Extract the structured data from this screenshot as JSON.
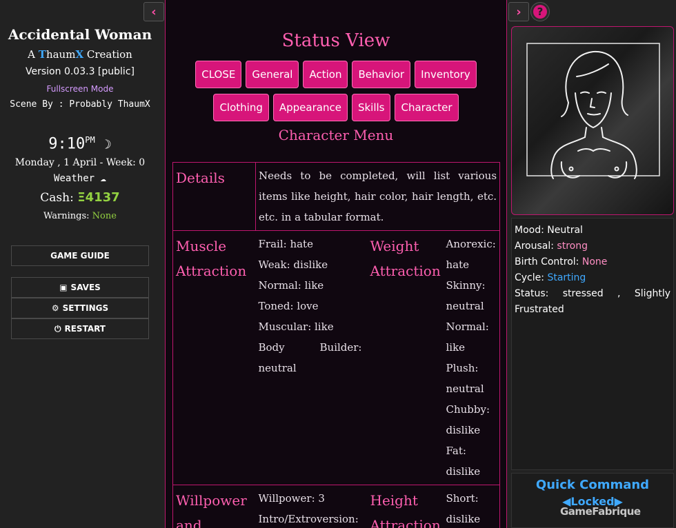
{
  "game": {
    "title": "Accidental Woman",
    "creation_prefix": "A ",
    "creation_first": "T",
    "creation_mid": "haum",
    "creation_x": "X",
    "creation_suffix": " Creation",
    "version": "Version 0.03.3 [public]",
    "fullscreen_label": "Fullscreen Mode",
    "scene_by": "Scene By : Probably ThaumX"
  },
  "clock": {
    "time": "9:10",
    "meridiem": "PM",
    "moon_icon": "☽",
    "date": "Monday , 1 April - Week: 0",
    "weather_label": "Weather",
    "weather_icon": "☁",
    "cash_label": "Cash: ",
    "cash_value": "Ξ4137",
    "warnings_label": "Warnings: ",
    "warnings_value": "None"
  },
  "left_menu": {
    "game_guide": "GAME GUIDE",
    "saves": "SAVES",
    "settings": "SETTINGS",
    "restart": "RESTART"
  },
  "icons": {
    "collapse_left": "‹",
    "expand_right": "›",
    "help": "?",
    "save": "💾",
    "gear": "⚙",
    "power": "⏻"
  },
  "status_view": {
    "title": "Status View",
    "buttons_row1": [
      "CLOSE",
      "General",
      "Action",
      "Behavior",
      "Inventory"
    ],
    "buttons_row2": [
      "Clothing",
      "Appearance",
      "Skills",
      "Character"
    ],
    "menu_title": "Character Menu"
  },
  "details": {
    "header": "Details",
    "text": "Needs to be completed, will list various items like height, hair color, hair length, etc. etc. in a tabular format."
  },
  "muscle": {
    "header_1": "Muscle",
    "header_2": "Attraction",
    "lines": [
      "Frail: hate",
      "Weak: dislike",
      "Normal: like",
      "Toned: love",
      "Muscular: like",
      "Body Builder: neutral"
    ]
  },
  "weight": {
    "header_1": "Weight",
    "header_2": "Attraction",
    "text": "Anorexic: hate Skinny: neutral Normal: like Plush: neutral Chubby: dislike Fat: dislike"
  },
  "willpower": {
    "header_1": "Willpower",
    "header_2": "and",
    "lines": [
      "Willpower: 3",
      "Intro/Extroversion:"
    ]
  },
  "height": {
    "header_1": "Height",
    "header_2": "Attraction",
    "text": "Short: dislike"
  },
  "status": {
    "mood_label": "Mood: ",
    "mood_value": "Neutral",
    "arousal_label": "Arousal: ",
    "arousal_value": "strong",
    "birth_label": "Birth Control: ",
    "birth_value": "None",
    "cycle_label": "Cycle: ",
    "cycle_value": "Starting",
    "status_line": "Status: stressed , Slightly",
    "status_line2": "Frustrated"
  },
  "quick": {
    "title": "Quick Command",
    "locked": "◀Locked▶"
  },
  "watermark": "GameFabrique",
  "colors": {
    "accent": "#d7157a",
    "header_pink": "#ff5fb0",
    "blue": "#3fa9ff",
    "green": "#93d141"
  }
}
